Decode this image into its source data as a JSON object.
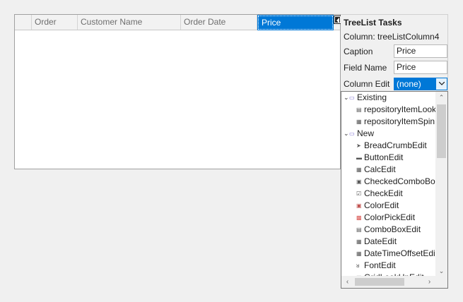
{
  "grid": {
    "columns": [
      "Order",
      "Customer Name",
      "Order Date",
      "Price"
    ],
    "selected_column": "Price"
  },
  "tasks": {
    "title": "TreeList Tasks",
    "column_info": "Column: treeListColumn4",
    "caption_label": "Caption",
    "caption_value": "Price",
    "field_name_label": "Field Name",
    "field_name_value": "Price",
    "column_edit_label": "Column Edit",
    "column_edit_value": "(none)"
  },
  "dropdown": {
    "groups": [
      {
        "label": "Existing",
        "icon": "folder-icon",
        "items": [
          {
            "label": "repositoryItemLookUpEdit",
            "icon": "lookup-edit-icon"
          },
          {
            "label": "repositoryItemSpinEdit",
            "icon": "spin-edit-icon"
          }
        ]
      },
      {
        "label": "New",
        "icon": "folder-icon",
        "items": [
          {
            "label": "BreadCrumbEdit",
            "icon": "breadcrumb-icon"
          },
          {
            "label": "ButtonEdit",
            "icon": "button-edit-icon"
          },
          {
            "label": "CalcEdit",
            "icon": "calc-edit-icon"
          },
          {
            "label": "CheckedComboBoxEdit",
            "icon": "checked-combo-icon"
          },
          {
            "label": "CheckEdit",
            "icon": "check-edit-icon"
          },
          {
            "label": "ColorEdit",
            "icon": "color-edit-icon"
          },
          {
            "label": "ColorPickEdit",
            "icon": "color-pick-icon"
          },
          {
            "label": "ComboBoxEdit",
            "icon": "combobox-icon"
          },
          {
            "label": "DateEdit",
            "icon": "date-edit-icon"
          },
          {
            "label": "DateTimeOffsetEdit",
            "icon": "datetime-offset-icon"
          },
          {
            "label": "FontEdit",
            "icon": "font-edit-icon"
          },
          {
            "label": "GridLookUpEdit",
            "icon": "grid-lookup-icon"
          }
        ]
      }
    ]
  },
  "colors": {
    "selection": "#0078d7",
    "panel_bg": "#f0f0f0"
  }
}
